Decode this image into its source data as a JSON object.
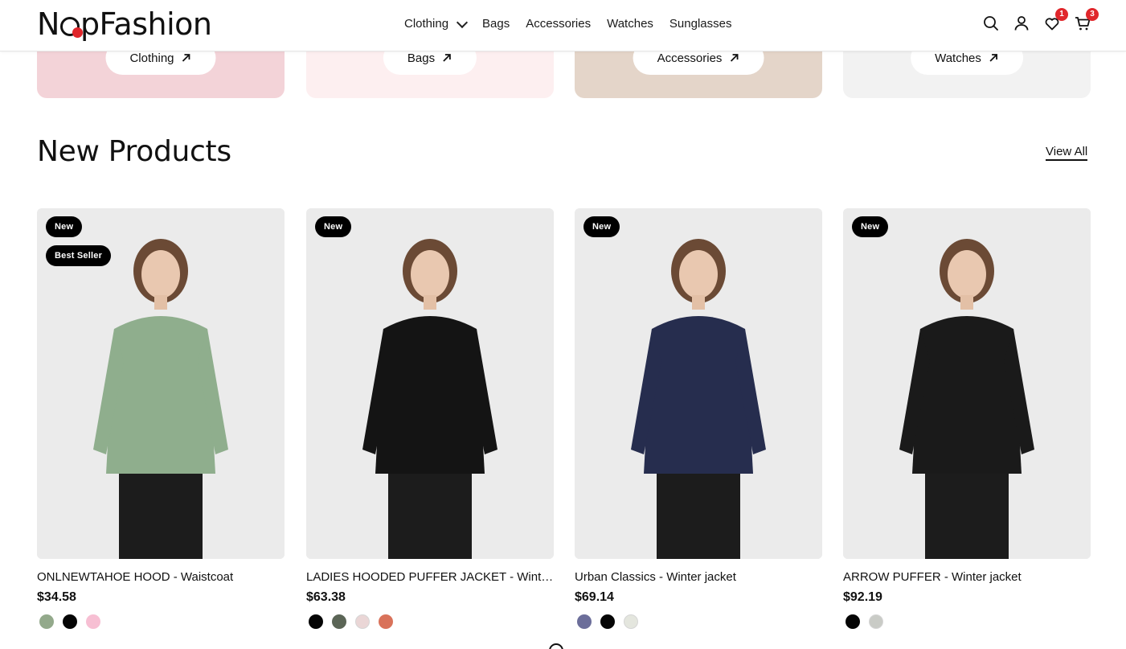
{
  "brand": {
    "name_start": "N",
    "name_end": "pFashion"
  },
  "nav": {
    "items": [
      "Clothing",
      "Bags",
      "Accessories",
      "Watches",
      "Sunglasses"
    ]
  },
  "header_icons": {
    "wishlist_count": "1",
    "cart_count": "3"
  },
  "categories": [
    {
      "label": "Clothing",
      "bg": "#f3d3d8"
    },
    {
      "label": "Bags",
      "bg": "#fdeff0"
    },
    {
      "label": "Accessories",
      "bg": "#e4d5c9"
    },
    {
      "label": "Watches",
      "bg": "#f2f2f2"
    }
  ],
  "section": {
    "title": "New Products",
    "view_all": "View All"
  },
  "products": [
    {
      "name": "ONLNEWTAHOE HOOD - Waistcoat",
      "price": "$34.58",
      "tags": [
        "New",
        "Best Seller"
      ],
      "jacket_color": "#8fae8d",
      "colors": [
        "#93a98b",
        "#050505",
        "#f7bfd3"
      ]
    },
    {
      "name": "LADIES HOODED PUFFER JACKET - Winter jacket",
      "price": "$63.38",
      "tags": [
        "New"
      ],
      "jacket_color": "#141414",
      "colors": [
        "#050505",
        "#5b6556",
        "#ead6d6",
        "#d9725a"
      ]
    },
    {
      "name": "Urban Classics - Winter jacket",
      "price": "$69.14",
      "tags": [
        "New"
      ],
      "jacket_color": "#262d4e",
      "colors": [
        "#6c6e9a",
        "#050505",
        "#e4e6de"
      ]
    },
    {
      "name": "ARROW PUFFER - Winter jacket",
      "price": "$92.19",
      "tags": [
        "New"
      ],
      "jacket_color": "#1a1a1a",
      "colors": [
        "#050505",
        "#c9cbc6"
      ]
    }
  ]
}
